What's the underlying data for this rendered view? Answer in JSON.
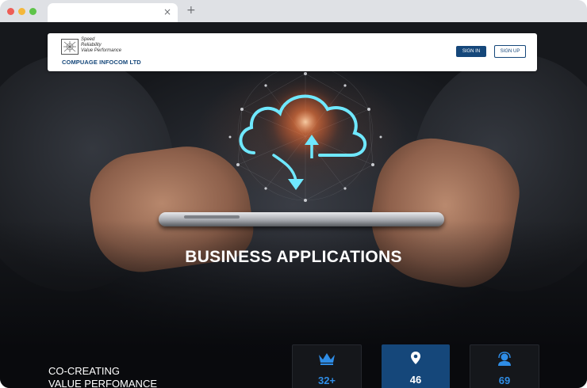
{
  "browser": {
    "tab_close": "×",
    "new_tab": "+"
  },
  "header": {
    "tagline_lines": [
      "Speed",
      "Reliability",
      "Value Performance"
    ],
    "company_name": "COMPUAGE INFOCOM LTD",
    "signin_label": "SIGN IN",
    "signup_label": "SIGN UP"
  },
  "hero": {
    "title": "BUSINESS APPLICATIONS",
    "tagline_lines": [
      "CO-CREATING",
      "VALUE PERFOMANCE"
    ]
  },
  "stats": [
    {
      "icon": "crown-icon",
      "value": "32+"
    },
    {
      "icon": "map-pin-icon",
      "value": "46"
    },
    {
      "icon": "support-agent-icon",
      "value": "69"
    }
  ],
  "colors": {
    "brand_blue": "#15477a",
    "stat_text_blue": "#2f8de6",
    "cloud_glow": "#6fe8ff"
  }
}
